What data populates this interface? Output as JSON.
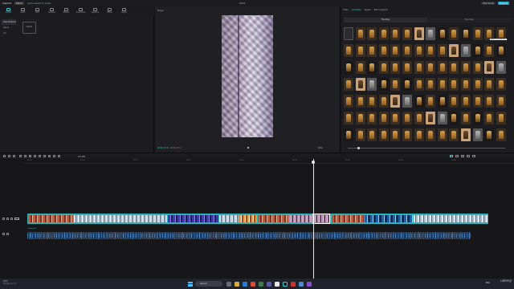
{
  "titlebar": {
    "app_name": "CapCut",
    "menu_label": "Menu",
    "project_name": "Auto-saved to local",
    "center_title": "0001",
    "right_pills": [
      "Shortcuts",
      "Export"
    ]
  },
  "media_toolbar": {
    "items": [
      "Import",
      "Audio",
      "Text",
      "Stickers",
      "Effects",
      "Transitions",
      "Captions",
      "Filters",
      "Adjust"
    ]
  },
  "left_panel": {
    "nav": [
      "Import device",
      "Space",
      "Lib"
    ],
    "import_label": "Import"
  },
  "player": {
    "title": "Player",
    "timecode_current": "00:00:17:23",
    "timecode_total": "00:00:27:13",
    "ratio_label": "Ratio"
  },
  "right_panel": {
    "tabs": [
      "Video",
      "Animation",
      "Speed",
      "Text to speech"
    ],
    "subtabs": [
      "Trending",
      "Favorites"
    ],
    "tooltip": "Added to Favorites"
  },
  "timeline": {
    "time_display": "17:23",
    "ruler_labels": [
      "00:00",
      "00:05",
      "00:10",
      "00:15",
      "00:20",
      "00:25",
      "00:30",
      "00:35",
      "00:40"
    ],
    "audio_label": "Extracted"
  },
  "taskbar": {
    "weather_temp": "33°C",
    "weather_desc": "Mostly sunny",
    "search_placeholder": "Search",
    "tray_time": "ENG"
  },
  "watermark": "udemy",
  "colors": {
    "accent": "#2ecfd6",
    "video_track": "#2ab3b7",
    "audio_track": "#1d2d45"
  }
}
